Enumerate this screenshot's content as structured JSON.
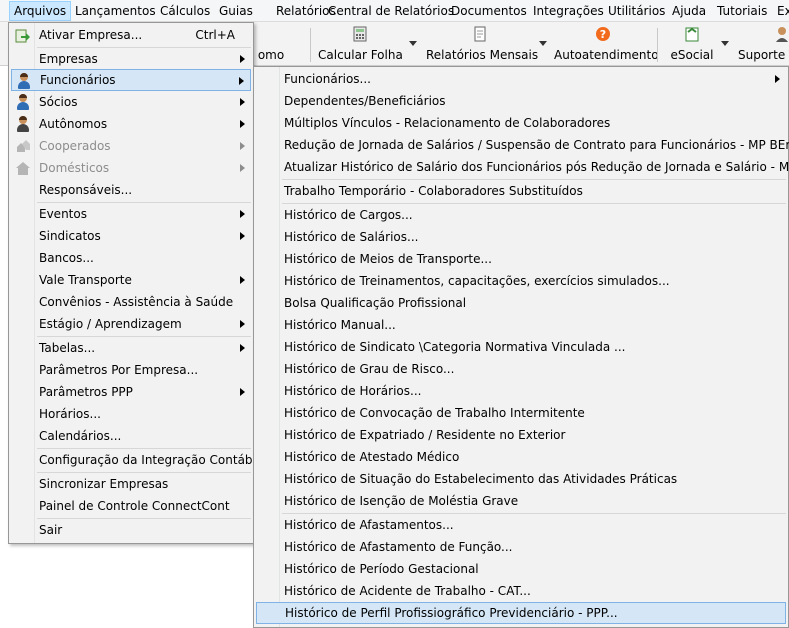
{
  "menubar": {
    "items": [
      "Arquivos",
      "Lançamentos",
      "Cálculos",
      "Guias",
      "Relatórios",
      "Central de Relatórios",
      "Documentos",
      "Integrações",
      "Utilitários",
      "Ajuda",
      "Tutoriais",
      "Ex"
    ]
  },
  "toolbar": {
    "items": [
      {
        "label": "omo",
        "icon": "partial-icon"
      },
      {
        "label": "Calcular Folha",
        "icon": "calculator-icon"
      },
      {
        "label": "Relatórios Mensais",
        "icon": "report-icon"
      },
      {
        "label": "Autoatendimento",
        "icon": "help-circle-icon"
      },
      {
        "label": "eSocial",
        "icon": "esocial-icon"
      },
      {
        "label": "Suporte T",
        "icon": "support-person-icon"
      }
    ]
  },
  "arquivos_menu": {
    "items": [
      {
        "label": "Ativar Empresa...",
        "shortcut": "Ctrl+A",
        "icon": "activate-company-icon"
      },
      {
        "label": "Empresas",
        "submenu": true
      },
      {
        "label": "Funcionários",
        "submenu": true,
        "highlighted": true,
        "icon": "employee-icon"
      },
      {
        "label": "Sócios",
        "submenu": true,
        "icon": "partner-icon"
      },
      {
        "label": "Autônomos",
        "submenu": true,
        "icon": "freelancer-icon"
      },
      {
        "label": "Cooperados",
        "submenu": true,
        "disabled": true,
        "icon": "cooperative-icon"
      },
      {
        "label": "Domésticos",
        "submenu": true,
        "disabled": true,
        "icon": "home-icon"
      },
      {
        "label": "Responsáveis..."
      },
      {
        "label": "Eventos",
        "submenu": true
      },
      {
        "label": "Sindicatos",
        "submenu": true
      },
      {
        "label": "Bancos..."
      },
      {
        "label": "Vale Transporte",
        "submenu": true
      },
      {
        "label": "Convênios - Assistência à Saúde"
      },
      {
        "label": "Estágio / Aprendizagem",
        "submenu": true
      },
      {
        "label": "Tabelas...",
        "submenu": true
      },
      {
        "label": "Parâmetros Por Empresa..."
      },
      {
        "label": "Parâmetros PPP",
        "submenu": true
      },
      {
        "label": "Horários..."
      },
      {
        "label": "Calendários..."
      },
      {
        "label": "Configuração da Integração Contábil"
      },
      {
        "label": "Sincronizar Empresas"
      },
      {
        "label": "Painel de Controle ConnectCont"
      },
      {
        "label": "Sair"
      }
    ]
  },
  "funcionarios_menu": {
    "items": [
      {
        "label": "Funcionários...",
        "submenu": true
      },
      {
        "label": "Dependentes/Beneficiários"
      },
      {
        "label": "Múltiplos Vínculos - Relacionamento de Colaboradores"
      },
      {
        "label": "Redução de Jornada de Salários / Suspensão de Contrato para Funcionários - MP BEm"
      },
      {
        "label": "Atualizar Histórico de Salário dos Funcionários pós Redução de Jornada e Salário - MP BEm"
      },
      {
        "label": "Trabalho Temporário - Colaboradores Substituídos"
      },
      {
        "label": "Histórico de Cargos..."
      },
      {
        "label": "Histórico de Salários..."
      },
      {
        "label": "Histórico de Meios de Transporte..."
      },
      {
        "label": "Histórico de Treinamentos, capacitações, exercícios simulados..."
      },
      {
        "label": "Bolsa Qualificação Profissional"
      },
      {
        "label": "Histórico Manual..."
      },
      {
        "label": "Histórico de Sindicato \\Categoria Normativa Vinculada ..."
      },
      {
        "label": "Histórico de Grau de Risco..."
      },
      {
        "label": "Histórico de Horários..."
      },
      {
        "label": "Histórico de Convocação de Trabalho Intermitente"
      },
      {
        "label": "Histórico de Expatriado / Residente no Exterior"
      },
      {
        "label": "Histórico de Atestado Médico"
      },
      {
        "label": "Histórico de Situação do Estabelecimento das Atividades Práticas"
      },
      {
        "label": "Histórico de Isenção de Moléstia Grave"
      },
      {
        "label": "Histórico de Afastamentos..."
      },
      {
        "label": "Histórico de Afastamento de Função..."
      },
      {
        "label": "Histórico de Período Gestacional"
      },
      {
        "label": "Histórico de Acidente de Trabalho - CAT..."
      },
      {
        "label": "Histórico de Perfil Profissiográfico Previdenciário - PPP...",
        "highlighted": true
      }
    ]
  },
  "colors": {
    "menu_bg": "#f2f2f2",
    "highlight_bg": "#d5e7f7",
    "highlight_border": "#7fb2e5",
    "menubar_active": "#cce8ff",
    "disabled_text": "#8d8d8d"
  }
}
